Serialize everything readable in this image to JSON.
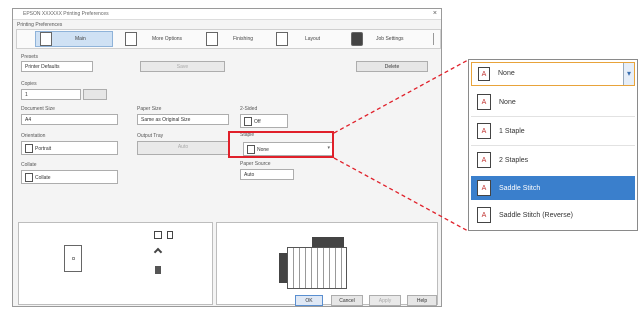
{
  "window": {
    "title": "EPSON XXXXXX Printing Preferences",
    "close_glyph": "×",
    "tab_section_label": "Printing Preferences"
  },
  "tabs": [
    {
      "label": "Main",
      "icon": "document-icon"
    },
    {
      "label": "More Options",
      "icon": "pages-icon"
    },
    {
      "label": "Finishing",
      "icon": "finishing-icon"
    },
    {
      "label": "Layout",
      "icon": "layout-icon"
    },
    {
      "label": "Job Settings",
      "icon": "printer-icon"
    }
  ],
  "main": {
    "presets_label": "Presets",
    "presets_value": "Printer Defaults",
    "save_button": "Save",
    "delete_button": "Delete",
    "copies_label": "Copies",
    "copies_value": "1",
    "document_size_label": "Document Size",
    "document_size_value": "A4",
    "paper_size_label": "Paper Size",
    "paper_size_value": "Same as Original Size",
    "orientation_label": "Orientation",
    "orientation_value": "Portrait",
    "output_tray_label": "Output Tray",
    "output_tray_value": "Auto",
    "sides_label": "2-Sided",
    "sides_value": "Off",
    "staple_label": "Staple",
    "staple_value": "None",
    "paper_source_label": "Paper Source",
    "paper_source_value": "Auto",
    "collate_label": "Collate",
    "collate_value": "Collate"
  },
  "footer": {
    "ok": "OK",
    "cancel": "Cancel",
    "apply": "Apply",
    "help": "Help"
  },
  "callout": {
    "selected": "None",
    "items": [
      {
        "label": "None",
        "icon": "A"
      },
      {
        "label": "1 Staple",
        "icon": "A"
      },
      {
        "label": "2 Staples",
        "icon": "A"
      },
      {
        "label": "Saddle Stitch",
        "icon": "A",
        "selected": true
      },
      {
        "label": "Saddle Stitch (Reverse)",
        "icon": "A"
      }
    ],
    "highlight_color": "#e0202a",
    "selection_color": "#3a7fcc"
  }
}
